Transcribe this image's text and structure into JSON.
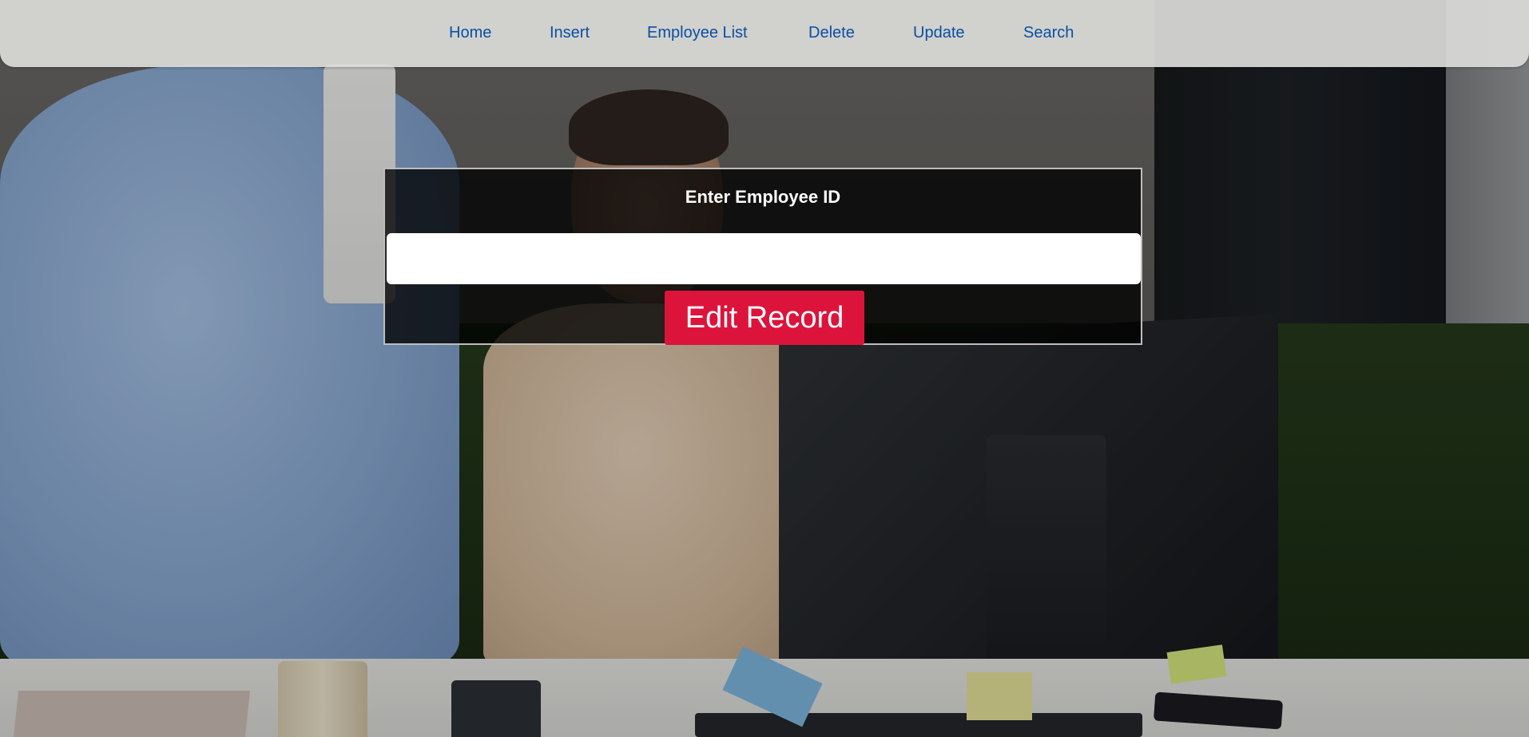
{
  "nav": {
    "items": [
      {
        "label": "Home"
      },
      {
        "label": "Insert"
      },
      {
        "label": "Employee List"
      },
      {
        "label": "Delete"
      },
      {
        "label": "Update"
      },
      {
        "label": "Search"
      }
    ]
  },
  "form": {
    "label": "Enter Employee ID",
    "input_value": "",
    "input_placeholder": "",
    "submit_label": "Edit Record"
  },
  "colors": {
    "nav_link": "#0b4fa3",
    "button_bg": "#dc143c",
    "button_text": "#ffffff",
    "panel_bg": "rgba(0,0,0,0.78)"
  }
}
